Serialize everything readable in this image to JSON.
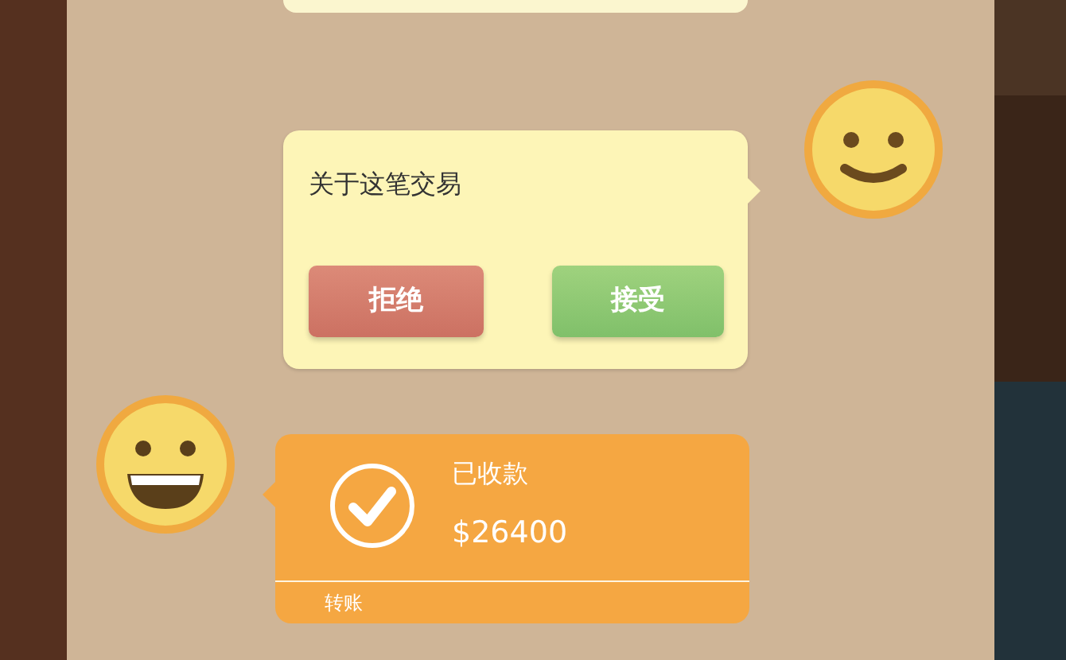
{
  "messages": [
    {
      "kind": "cut_off"
    },
    {
      "kind": "offer",
      "outgoing": true,
      "avatar": {
        "kind": "smile"
      },
      "text": "关于这笔交易",
      "buttons": [
        {
          "kind": "decline",
          "label": "拒绝"
        },
        {
          "kind": "accept",
          "label": "接受"
        }
      ]
    },
    {
      "kind": "transfer",
      "outgoing": false,
      "avatar": {
        "kind": "grin"
      },
      "status": "已收款",
      "amount": "$26400",
      "footer": "转账"
    }
  ]
}
